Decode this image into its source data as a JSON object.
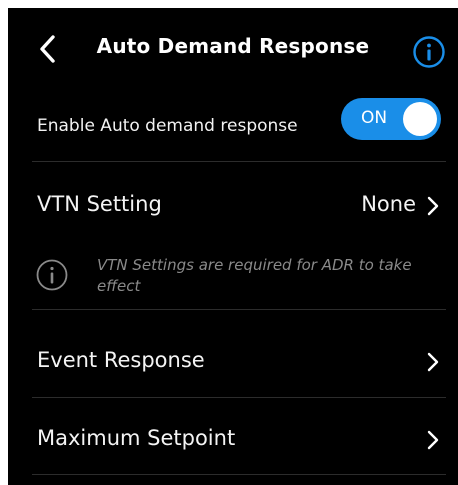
{
  "header": {
    "title": "Auto Demand Response"
  },
  "enable_row": {
    "label": "Enable Auto demand response",
    "toggle_text": "ON",
    "toggle_on": true
  },
  "vtn_setting": {
    "label": "VTN Setting",
    "value": "None"
  },
  "note": {
    "text": "VTN Settings are required for ADR to take effect"
  },
  "event_response": {
    "label": "Event Response"
  },
  "maximum_setpoint": {
    "label": "Maximum Setpoint"
  },
  "colors": {
    "background": "#000000",
    "accent": "#1a8ee8",
    "divider": "#2c2c2c",
    "muted_text": "#8a8a8a"
  },
  "icons": [
    "chevron-left-icon",
    "info-icon",
    "chevron-right-icon"
  ]
}
